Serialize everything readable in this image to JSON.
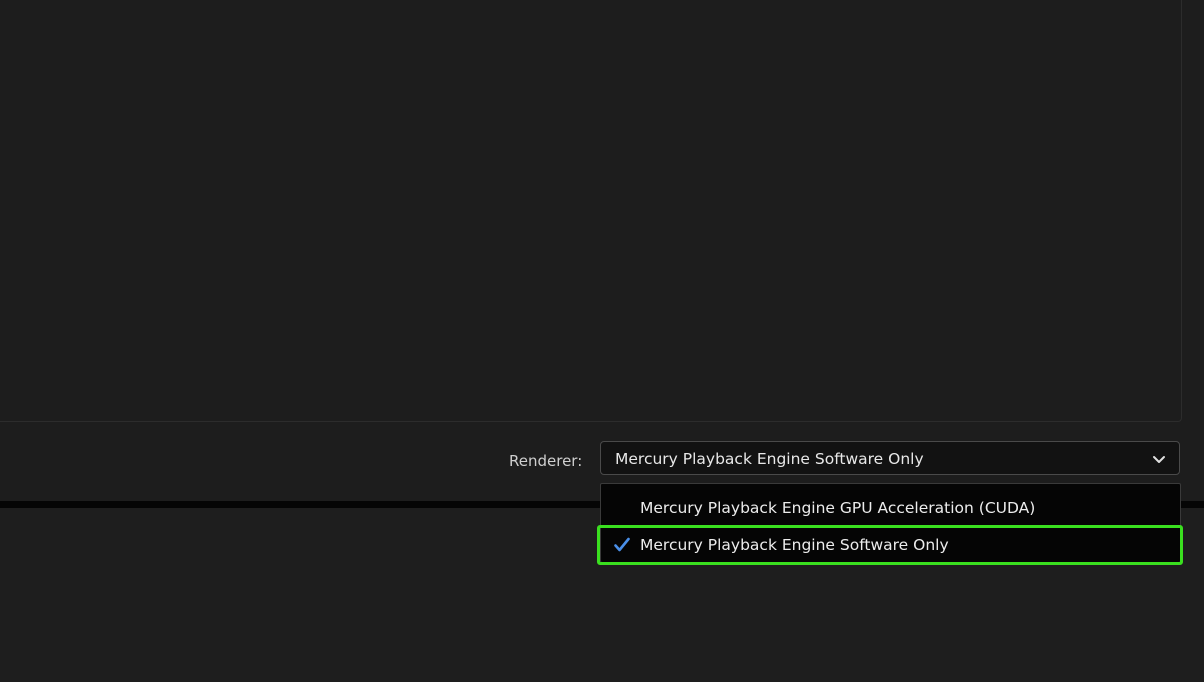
{
  "renderer": {
    "label": "Renderer:",
    "selected_value": "Mercury Playback Engine Software Only",
    "chevron_icon": "chevron-down-icon",
    "options": [
      {
        "label": "Mercury Playback Engine GPU Acceleration (CUDA)",
        "checked": false
      },
      {
        "label": "Mercury Playback Engine Software Only",
        "checked": true
      }
    ],
    "check_icon": "checkmark-icon"
  },
  "colors": {
    "background": "#1d1d1d",
    "select_bg": "#121212",
    "menu_bg": "#050505",
    "check": "#4a8fe8",
    "highlight": "#3adf1f"
  }
}
